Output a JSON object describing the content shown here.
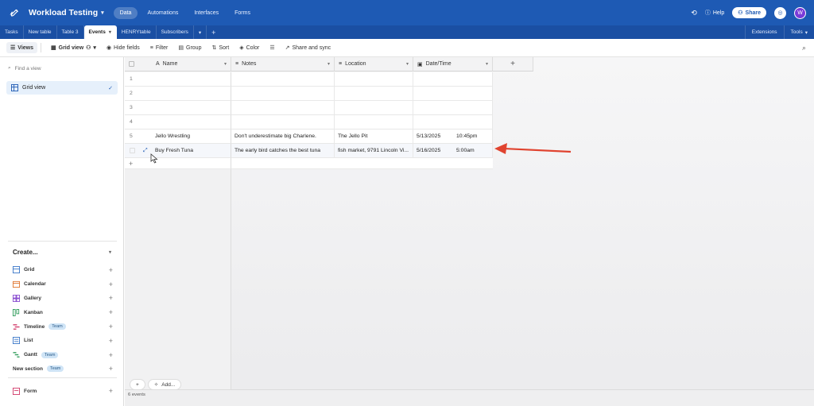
{
  "header": {
    "base_title": "Workload Testing",
    "nav": [
      "Data",
      "Automations",
      "Interfaces",
      "Forms"
    ],
    "help": "Help",
    "share": "Share",
    "avatar_initial": "W"
  },
  "tables": {
    "tabs": [
      "Tasks",
      "New table",
      "Table 3",
      "Events",
      "HENRYtable",
      "Subscribers"
    ],
    "active_tab": "Events",
    "right": [
      "Extensions",
      "Tools"
    ]
  },
  "toolbar": {
    "views": "Views",
    "grid_view": "Grid view",
    "hide_fields": "Hide fields",
    "filter": "Filter",
    "group": "Group",
    "sort": "Sort",
    "color": "Color",
    "share_sync": "Share and sync"
  },
  "sidebar": {
    "find_placeholder": "Find a view",
    "active_view": "Grid view",
    "create_label": "Create...",
    "create_items": [
      {
        "label": "Grid",
        "badge": ""
      },
      {
        "label": "Calendar",
        "badge": ""
      },
      {
        "label": "Gallery",
        "badge": ""
      },
      {
        "label": "Kanban",
        "badge": ""
      },
      {
        "label": "Timeline",
        "badge": "Team"
      },
      {
        "label": "List",
        "badge": ""
      },
      {
        "label": "Gantt",
        "badge": "Team"
      },
      {
        "label": "New section",
        "badge": "Team"
      }
    ],
    "form_label": "Form"
  },
  "grid": {
    "columns": [
      "Name",
      "Notes",
      "Location",
      "Date/Time"
    ],
    "rows": [
      {
        "num": "1",
        "name": "",
        "notes": "",
        "location": "",
        "date": "",
        "time": ""
      },
      {
        "num": "2",
        "name": "",
        "notes": "",
        "location": "",
        "date": "",
        "time": ""
      },
      {
        "num": "3",
        "name": "",
        "notes": "",
        "location": "",
        "date": "",
        "time": ""
      },
      {
        "num": "4",
        "name": "",
        "notes": "",
        "location": "",
        "date": "",
        "time": ""
      },
      {
        "num": "5",
        "name": "Jello Wrestling",
        "notes": "Don't underestimate big Charlene.",
        "location": "The Jello Pit",
        "date": "5/13/2025",
        "time": "10:45pm"
      },
      {
        "num": "",
        "name": "Buy Fresh Tuna",
        "notes": "The early bird catches the best tuna",
        "location": "fish market, 9791 Lincoln Vi...",
        "date": "5/16/2025",
        "time": "5:00am"
      }
    ],
    "add_label": "Add...",
    "record_count": "6 events"
  },
  "colors": {
    "brand": "#1e5ab4",
    "arrow": "#e0432f"
  }
}
